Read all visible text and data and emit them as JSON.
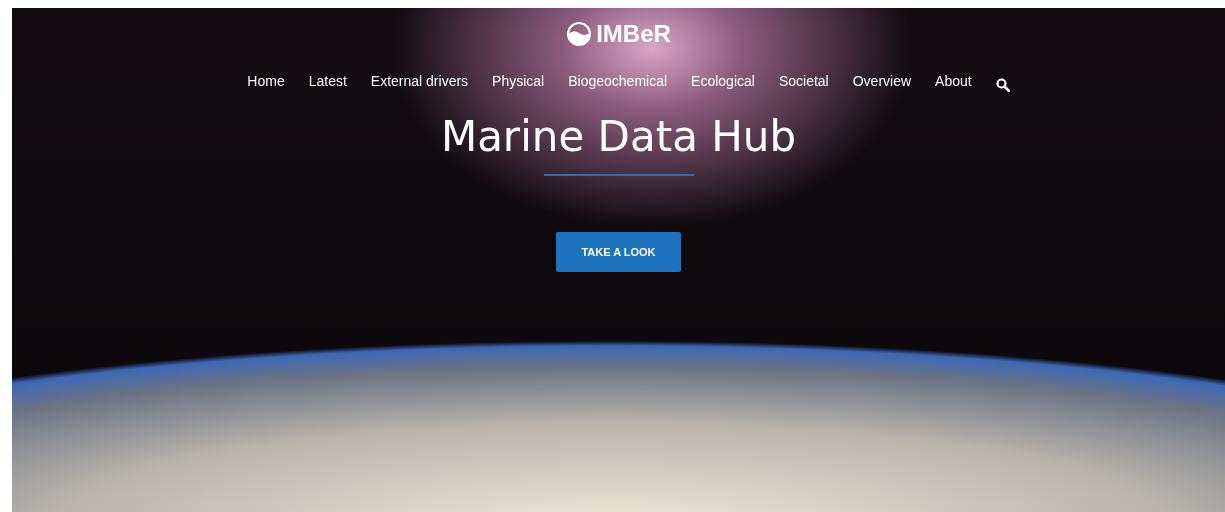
{
  "logo": {
    "text": "IMBeR"
  },
  "nav": {
    "items": [
      {
        "label": "Home"
      },
      {
        "label": "Latest"
      },
      {
        "label": "External drivers"
      },
      {
        "label": "Physical"
      },
      {
        "label": "Biogeochemical"
      },
      {
        "label": "Ecological"
      },
      {
        "label": "Societal"
      },
      {
        "label": "Overview"
      },
      {
        "label": "About"
      }
    ]
  },
  "hero": {
    "title": "Marine Data Hub",
    "button": "TAKE A LOOK"
  }
}
